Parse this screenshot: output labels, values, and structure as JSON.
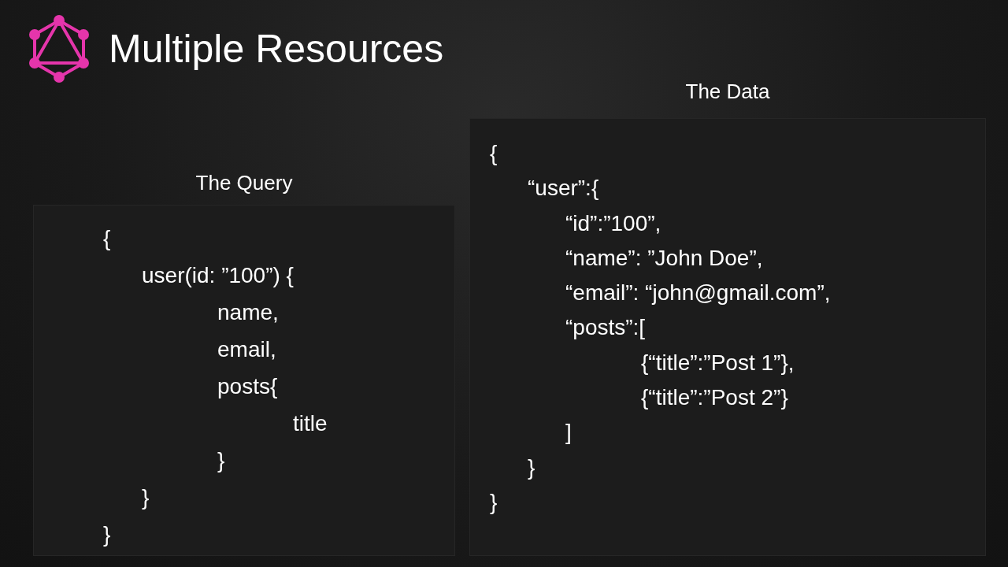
{
  "slide": {
    "title": "Multiple Resources"
  },
  "query": {
    "heading": "The Query",
    "lines": [
      {
        "text": "{",
        "children": [
          {
            "text": "user(id: ”100”) {",
            "children": [
              {
                "text": "name,"
              },
              {
                "text": "email,"
              },
              {
                "text": "posts{",
                "children": [
                  {
                    "text": "title"
                  }
                ]
              },
              {
                "text": "}"
              }
            ]
          },
          {
            "text": "}"
          }
        ]
      },
      {
        "text": "}"
      }
    ]
  },
  "data": {
    "heading": "The Data",
    "lines": [
      {
        "text": "{",
        "children": [
          {
            "text": "“user”:{",
            "children": [
              {
                "text": "“id”:”100”,"
              },
              {
                "text": "“name”: ”John Doe”,"
              },
              {
                "text": "“email”: “john@gmail.com”,"
              },
              {
                "text": "“posts”:[",
                "children": [
                  {
                    "text": "{“title”:”Post 1”},"
                  },
                  {
                    "text": "{“title”:”Post 2”}"
                  }
                ]
              },
              {
                "text": "]"
              }
            ]
          },
          {
            "text": "}"
          }
        ]
      },
      {
        "text": "}"
      }
    ]
  }
}
